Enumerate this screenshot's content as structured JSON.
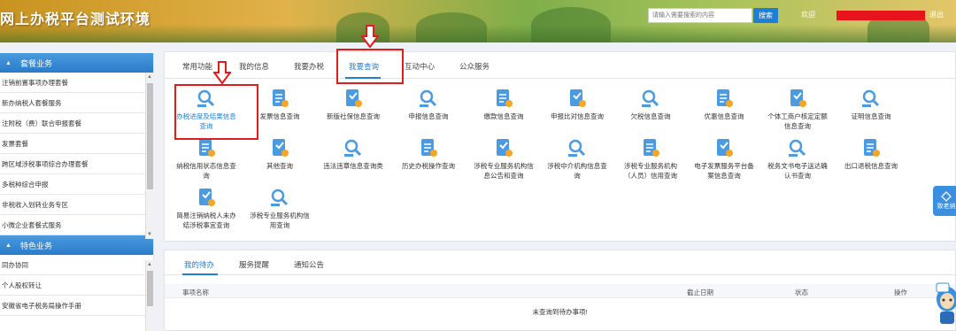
{
  "header": {
    "title": "网上办税平台测试环境",
    "search_placeholder": "请输入需要搜索的内容",
    "search_button": "搜索",
    "user_prefix": "欢迎",
    "logout": "退出"
  },
  "sidebar": {
    "section1": "套餐业务",
    "items1": [
      "注销前置事项办理套餐",
      "新办纳税人套餐服务",
      "注附税（费）联合申报套餐",
      "发票套餐",
      "跨区域涉税事项综合办理套餐",
      "多税种综合申报",
      "非税收入划转业务专区",
      "小微企业套餐式服务"
    ],
    "section2": "特色业务",
    "items2": [
      "同办协同",
      "个人股权转让",
      "安徽省电子税务局操作手册"
    ]
  },
  "tabs": [
    "常用功能",
    "我的信息",
    "我要办税",
    "我要查询",
    "互动中心",
    "公众服务"
  ],
  "active_tab": "我要查询",
  "grid": [
    {
      "label": "办税进度及结果信息查询",
      "icon": "search-magnifier-icon",
      "highlight": true
    },
    {
      "label": "发票信息查询",
      "icon": "invoice-doc-icon"
    },
    {
      "label": "新版社保信息查询",
      "icon": "social-doc-icon"
    },
    {
      "label": "申报信息查询",
      "icon": "declare-doc-icon"
    },
    {
      "label": "缴款信息查询",
      "icon": "payment-user-icon"
    },
    {
      "label": "申报比对信息查询",
      "icon": "compare-doc-icon"
    },
    {
      "label": "欠税信息查询",
      "icon": "arrears-icon"
    },
    {
      "label": "优惠信息查询",
      "icon": "discount-doc-icon"
    },
    {
      "label": "个体工商户核定定额信息查询",
      "icon": "business-bag-icon"
    },
    {
      "label": "证明信息查询",
      "icon": "certificate-icon"
    },
    {
      "label": "纳税信用状态信息查询",
      "icon": "credit-icon"
    },
    {
      "label": "其他查询",
      "icon": "chat-icon"
    },
    {
      "label": "违法违章信息查询类",
      "icon": "warning-icon"
    },
    {
      "label": "历史办税操作查询",
      "icon": "history-clock-icon"
    },
    {
      "label": "涉税专业服务机构信息公告和查询",
      "icon": "agency-doc-icon"
    },
    {
      "label": "涉税中介机构信息查询",
      "icon": "agency-building-icon"
    },
    {
      "label": "涉税专业服务机构（人员）信用查询",
      "icon": "agency-staff-icon"
    },
    {
      "label": "电子发票服务平台备案信息查询",
      "icon": "e-invoice-icon"
    },
    {
      "label": "税务文书电子送达确认书查询",
      "icon": "document-delivery-icon"
    },
    {
      "label": "出口退税信息查询",
      "icon": "export-refund-icon"
    },
    {
      "label": "简易注销纳税人未办结涉税事宜查询",
      "icon": "simple-cancel-icon"
    },
    {
      "label": "涉税专业服务机构信用查询",
      "icon": "agency-credit-icon"
    }
  ],
  "todo": {
    "tabs": [
      "我的待办",
      "服务提醒",
      "通知公告"
    ],
    "headers": [
      "事项名称",
      "截止日期",
      "状态",
      "操作"
    ],
    "empty_text": "未查询到待办事项!"
  },
  "float_button": "致老纳",
  "colors": {
    "accent": "#1f7fd6",
    "highlight_box": "#e31b1b"
  }
}
